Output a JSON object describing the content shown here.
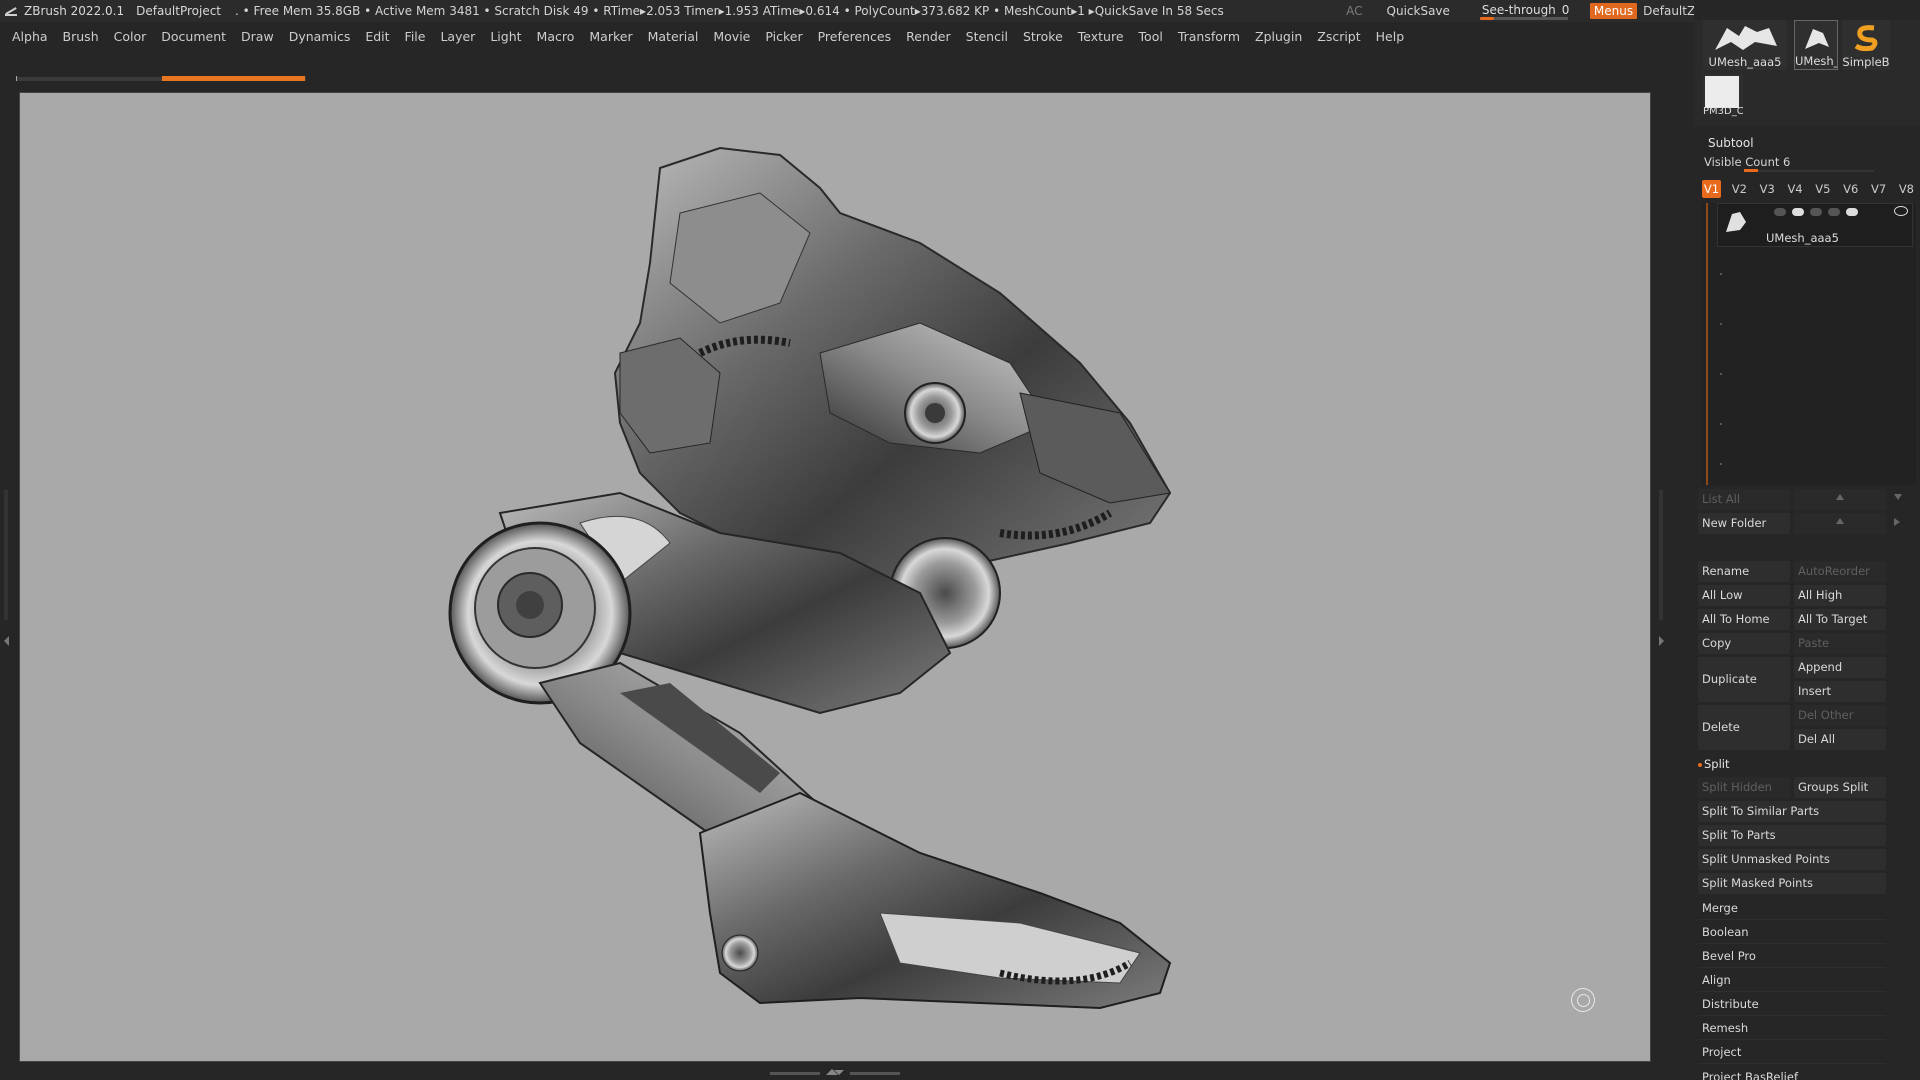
{
  "titlebar": {
    "app": "ZBrush 2022.0.1",
    "project": "DefaultProject",
    "stats": ". • Free Mem 35.8GB • Active Mem 3481 • Scratch Disk 49 •  RTime▸2.053 Timer▸1.953 ATime▸0.614 • PolyCount▸373.682 KP  • MeshCount▸1  ▸QuickSave In 58 Secs",
    "ac": "AC",
    "quicksave": "QuickSave",
    "seethrough_label": "See-through",
    "seethrough_value": "0",
    "menus": "Menus",
    "script": "DefaultZScript",
    "accent": "#e86a1c"
  },
  "menubar": [
    "Alpha",
    "Brush",
    "Color",
    "Document",
    "Draw",
    "Dynamics",
    "Edit",
    "File",
    "Layer",
    "Light",
    "Macro",
    "Marker",
    "Material",
    "Movie",
    "Picker",
    "Preferences",
    "Render",
    "Stencil",
    "Stroke",
    "Texture",
    "Tool",
    "Transform",
    "Zplugin",
    "Zscript",
    "Help"
  ],
  "viewport": {
    "background": "#aaa9a9"
  },
  "panel": {
    "thumbs": [
      "UMesh_aaa5",
      "UMesh_",
      "SimpleB",
      "PM3D_C"
    ],
    "subtool_title": "Subtool",
    "visible_count": "Visible Count 6",
    "versions": [
      "V1",
      "V2",
      "V3",
      "V4",
      "V5",
      "V6",
      "V7",
      "V8"
    ],
    "active_version": "V1",
    "subtool_name": "UMesh_aaa5",
    "list_all": "List All",
    "new_folder": "New Folder",
    "rename": "Rename",
    "auto_reorder": "AutoReorder",
    "all_low": "All Low",
    "all_high": "All High",
    "all_to_home": "All To Home",
    "all_to_target": "All To Target",
    "copy": "Copy",
    "paste": "Paste",
    "duplicate": "Duplicate",
    "append": "Append",
    "insert": "Insert",
    "delete": "Delete",
    "del_other": "Del Other",
    "del_all": "Del All",
    "split": "Split",
    "split_hidden": "Split Hidden",
    "groups_split": "Groups Split",
    "split_similar": "Split To Similar Parts",
    "split_parts": "Split To Parts",
    "split_unmasked": "Split Unmasked Points",
    "split_masked": "Split Masked Points",
    "merge": "Merge",
    "boolean": "Boolean",
    "bevel_pro": "Bevel Pro",
    "align": "Align",
    "distribute": "Distribute",
    "remesh": "Remesh",
    "project": "Project",
    "project_bas": "Project BasRelief"
  }
}
